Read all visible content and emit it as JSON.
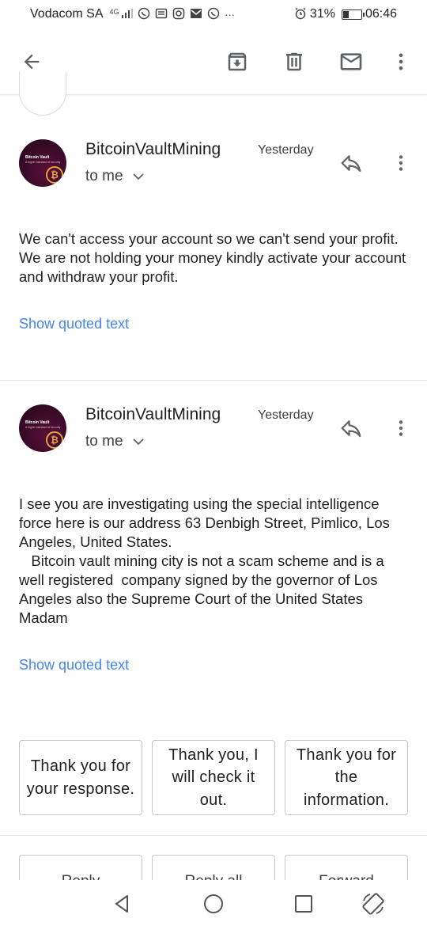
{
  "status_bar": {
    "carrier": "Vodacom SA",
    "network": "4G",
    "battery_percent": "31%",
    "battery_level": 0.31,
    "time": "06:46"
  },
  "toolbar": {
    "back_icon": "arrow-left-icon",
    "archive_icon": "archive-icon",
    "delete_icon": "trash-icon",
    "mark_unread_icon": "mail-icon",
    "more_icon": "more-vert-icon"
  },
  "messages": [
    {
      "sender": "BitcoinVaultMining",
      "date": "Yesterday",
      "recipient": "to me",
      "avatar_title": "Bitcoin Vault",
      "avatar_subtitle": "A higher standard of security",
      "body": "We can't access your account so we can't send your profit. We are not holding your money kindly activate your account and withdraw your profit.",
      "show_quoted": "Show quoted text"
    },
    {
      "sender": "BitcoinVaultMining",
      "date": "Yesterday",
      "recipient": "to me",
      "avatar_title": "Bitcoin Vault",
      "avatar_subtitle": "A higher standard of security",
      "body": "I see you are investigating using the special intelligence force here is our address 63 Denbigh Street, Pimlico, Los Angeles, United States.\n   Bitcoin vault mining city is not a scam scheme and is a well registered  company signed by the governor of Los Angeles also the Supreme Court of the United States Madam",
      "show_quoted": "Show quoted text"
    }
  ],
  "smart_replies": [
    "Thank you for your response.",
    "Thank you, I will check it out.",
    "Thank you for the information."
  ],
  "actions": [
    "Reply",
    "Reply all",
    "Forward"
  ],
  "accent_color": "#4285f4"
}
